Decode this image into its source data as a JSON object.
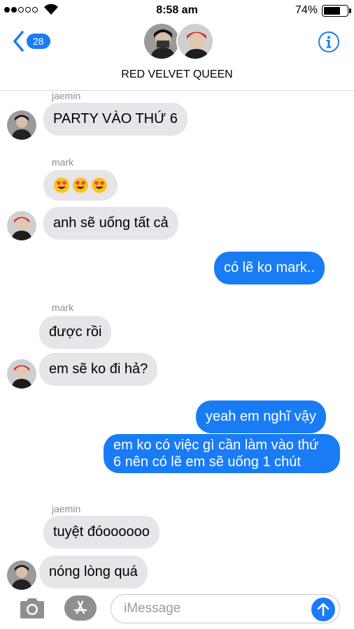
{
  "status_bar": {
    "signal_dots_filled": 2,
    "signal_dots_total": 5,
    "time": "8:58 am",
    "battery_percent_label": "74%",
    "battery_level": 0.74
  },
  "header": {
    "back_badge": "28",
    "group_name": "RED VELVET QUEEN"
  },
  "messages": [
    {
      "sender": "jaemin",
      "text": "PARTY VÀO THỨ 6",
      "direction": "in"
    },
    {
      "sender": "mark",
      "text": "",
      "emojis": [
        "smiling-face-with-heart-eyes",
        "smiling-face-with-heart-eyes",
        "smiling-face-with-heart-eyes"
      ],
      "direction": "in"
    },
    {
      "text": "anh sẽ uống tất cả",
      "direction": "in"
    },
    {
      "text": "có lẽ ko mark..",
      "direction": "out"
    },
    {
      "sender": "mark",
      "text": "được rồi",
      "direction": "in"
    },
    {
      "text": "em sẽ ko đi hả?",
      "direction": "in"
    },
    {
      "text": "yeah em nghĩ vậy",
      "direction": "out"
    },
    {
      "text": "em ko có việc gì cần làm vào thứ 6 nên có lẽ em sẽ uống 1 chút",
      "direction": "out"
    },
    {
      "sender": "jaemin",
      "text": "tuyệt đóoooooo",
      "direction": "in"
    },
    {
      "text": "nóng lòng quá",
      "direction": "in"
    }
  ],
  "input_bar": {
    "placeholder": "iMessage"
  },
  "colors": {
    "accent": "#1a7cf5",
    "incoming_bubble": "#e5e5ea",
    "sender_label": "#8e8e93"
  },
  "icons": [
    "back-chevron-icon",
    "info-icon",
    "camera-icon",
    "app-store-icon",
    "send-arrow-icon",
    "wifi-icon",
    "battery-icon"
  ]
}
